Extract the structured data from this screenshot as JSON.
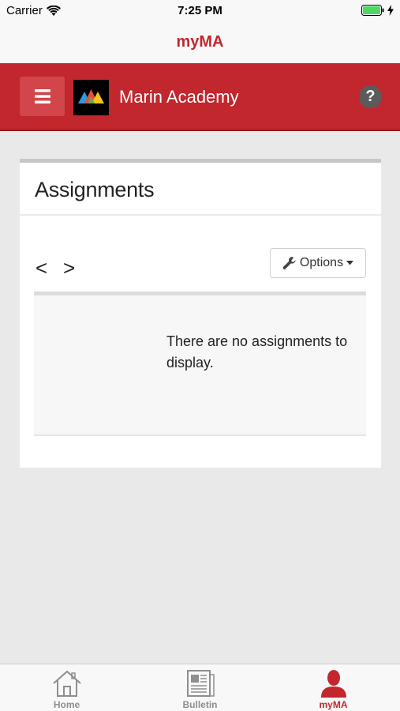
{
  "status_bar": {
    "carrier": "Carrier",
    "time": "7:25 PM"
  },
  "nav": {
    "title": "myMA"
  },
  "header": {
    "school_name": "Marin Academy",
    "help_label": "?"
  },
  "assignments": {
    "title": "Assignments",
    "prev_label": "<",
    "next_label": ">",
    "options_label": "Options",
    "empty_message": "There are no assignments to display."
  },
  "tabs": [
    {
      "label": "Home",
      "icon": "home-icon",
      "active": false
    },
    {
      "label": "Bulletin",
      "icon": "newspaper-icon",
      "active": false
    },
    {
      "label": "myMA",
      "icon": "person-icon",
      "active": true
    }
  ],
  "colors": {
    "brand": "#c1272d",
    "tab_inactive": "#8e8e8e",
    "battery": "#4cd964"
  }
}
